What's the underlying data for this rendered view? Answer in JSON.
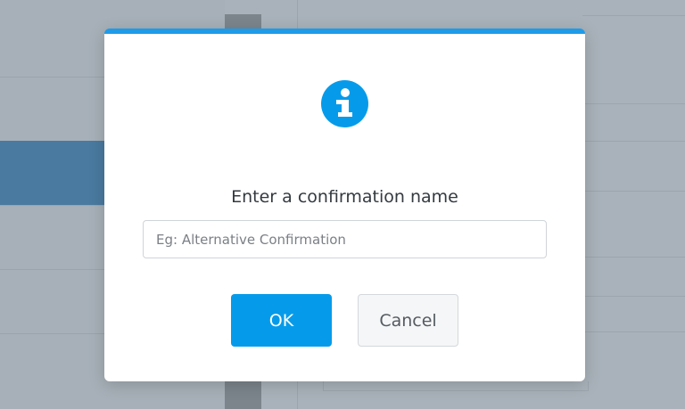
{
  "dialog": {
    "icon": "info-icon",
    "prompt": "Enter a confirmation name",
    "input": {
      "value": "",
      "placeholder": "Eg: Alternative Confirmation"
    },
    "ok_label": "OK",
    "cancel_label": "Cancel",
    "accent_color": "#1e9be9"
  }
}
